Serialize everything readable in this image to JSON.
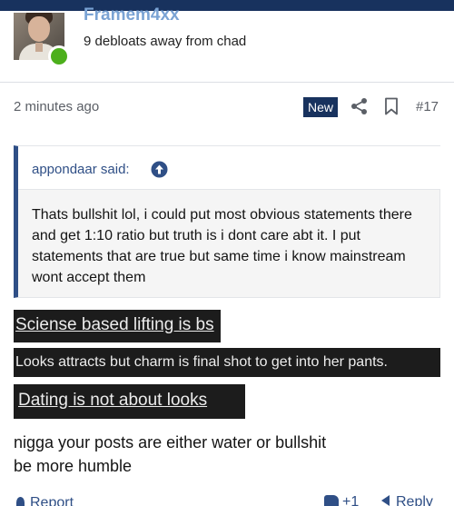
{
  "user": {
    "name": "Framem4xx",
    "title": "9 debloats away from chad",
    "status": "online"
  },
  "post": {
    "time": "2 minutes ago",
    "badge": "New",
    "number": "#17",
    "icons": [
      "share-icon",
      "bookmark-icon"
    ]
  },
  "quote": {
    "author": "appondaar said:",
    "text": "Thats bullshit lol, i could put most obvious statements there and get 1:10 ratio but truth is i dont care abt it. I put statements that are true but same time i know mainstream wont accept them"
  },
  "images": [
    {
      "text": "Sciense based lifting is bs"
    },
    {
      "text": "Looks attracts but charm is final shot to get into her pants."
    },
    {
      "text": "Dating is not about looks"
    }
  ],
  "reply": {
    "line1": "nigga your posts are either water or bullshit",
    "line2": "be more humble"
  },
  "footer": {
    "report": "Report",
    "like": "+1",
    "reply": "Reply"
  },
  "colors": {
    "navy": "#18325e",
    "link": "#2f4f86",
    "username": "#7aa3d4",
    "online": "#4caf1c"
  }
}
